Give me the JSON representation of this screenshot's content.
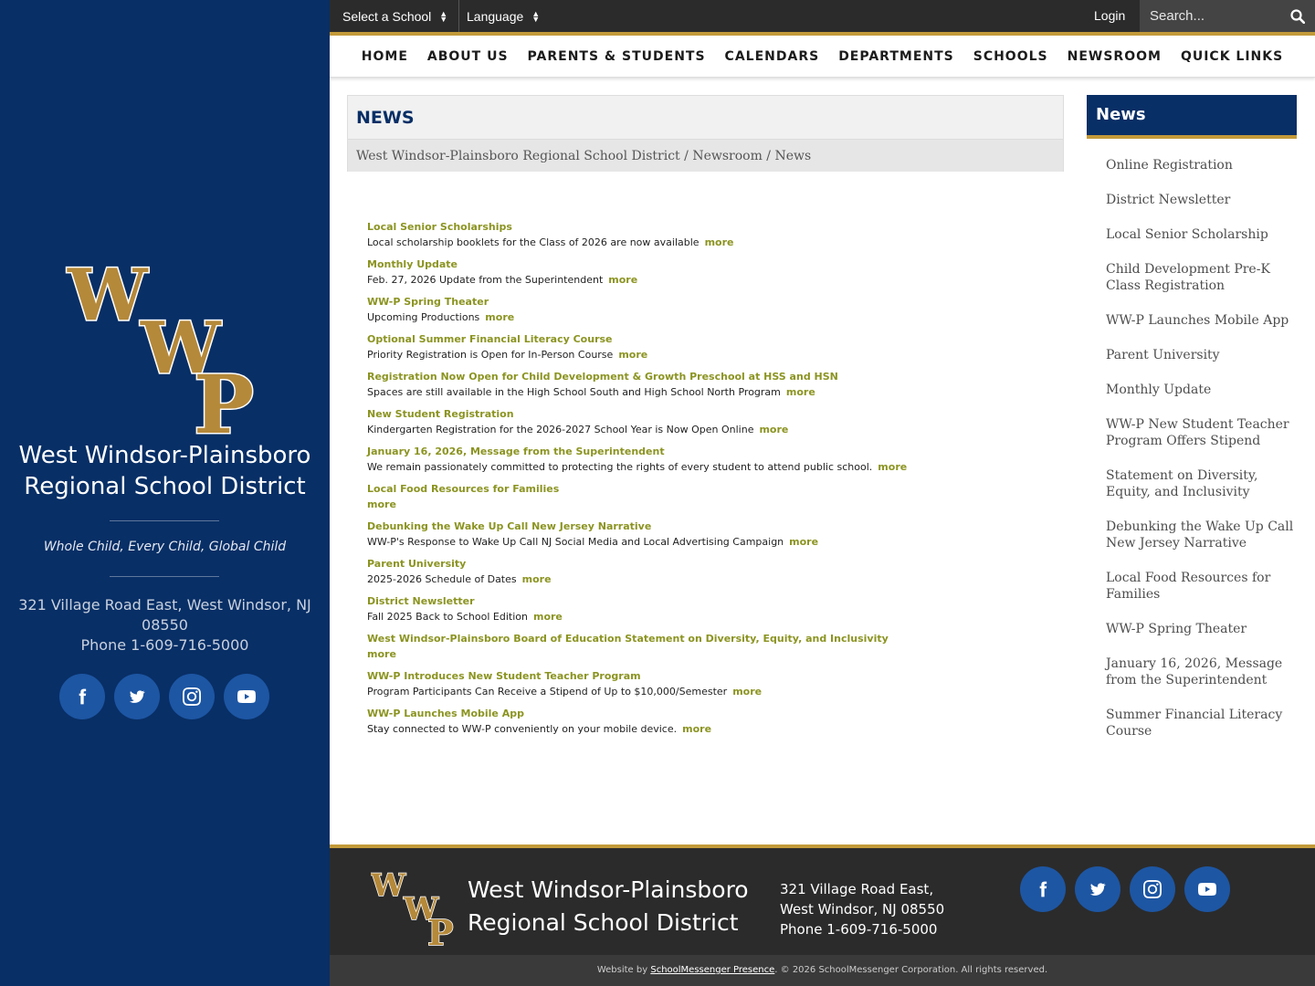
{
  "sidebar": {
    "district_name_line1": "West Windsor-Plainsboro",
    "district_name_line2": "Regional School District",
    "tagline": "Whole Child, Every Child, Global Child",
    "address_line1": "321 Village Road East, West Windsor, NJ",
    "address_line2": "08550",
    "phone": "Phone 1-609-716-5000",
    "logo_letters": [
      "W",
      "W",
      "P"
    ]
  },
  "topbar": {
    "select_school": "Select a School",
    "language": "Language",
    "login": "Login",
    "search_placeholder": "Search..."
  },
  "nav": {
    "items": [
      "HOME",
      "ABOUT US",
      "PARENTS & STUDENTS",
      "CALENDARS",
      "DEPARTMENTS",
      "SCHOOLS",
      "NEWSROOM",
      "QUICK LINKS"
    ]
  },
  "page": {
    "title": "NEWS",
    "breadcrumb": [
      "West Windsor-Plainsboro Regional School District",
      "Newsroom",
      "News"
    ],
    "breadcrumb_sep": " / "
  },
  "news": [
    {
      "title": "Local Senior Scholarships",
      "desc": "Local scholarship booklets for the Class of 2026 are now available",
      "more": "more"
    },
    {
      "title": "Monthly Update",
      "desc": "Feb. 27, 2026 Update from the Superintendent",
      "more": "more"
    },
    {
      "title": "WW-P Spring Theater",
      "desc": "Upcoming Productions",
      "more": "more"
    },
    {
      "title": "Optional Summer Financial Literacy Course",
      "desc": "Priority Registration is Open for In-Person Course",
      "more": "more"
    },
    {
      "title": "Registration Now Open for Child Development & Growth Preschool at HSS and HSN",
      "desc": "Spaces are still available in the High School South and High School North Program",
      "more": "more"
    },
    {
      "title": "New Student Registration",
      "desc": "Kindergarten Registration for the 2026-2027 School Year is Now Open Online",
      "more": "more"
    },
    {
      "title": "January 16, 2026, Message from the Superintendent",
      "desc": "We remain passionately committed to protecting the rights of every student to attend public school.",
      "more": "more"
    },
    {
      "title": "Local Food Resources for Families",
      "desc": "",
      "more": "more"
    },
    {
      "title": "Debunking the Wake Up Call New Jersey Narrative",
      "desc": "WW-P's Response to Wake Up Call NJ Social Media and Local Advertising Campaign",
      "more": "more"
    },
    {
      "title": "Parent University",
      "desc": "2025-2026 Schedule of Dates",
      "more": "more"
    },
    {
      "title": "District Newsletter",
      "desc": "Fall 2025 Back to School Edition",
      "more": "more"
    },
    {
      "title": "West Windsor-Plainsboro Board of Education Statement on Diversity, Equity, and Inclusivity",
      "desc": "",
      "more": "more"
    },
    {
      "title": "WW-P Introduces New Student Teacher Program",
      "desc": "Program Participants Can Receive a Stipend of Up to $10,000/Semester",
      "more": "more"
    },
    {
      "title": "WW-P Launches Mobile App",
      "desc": "Stay connected to WW-P conveniently on your mobile device.",
      "more": "more"
    }
  ],
  "rightnav": {
    "header": "News",
    "items": [
      "Online Registration",
      "District Newsletter",
      "Local Senior Scholarship",
      "Child Development Pre-K Class Registration",
      "WW-P Launches Mobile App",
      "Parent University",
      "Monthly Update",
      "WW-P New Student Teacher Program Offers Stipend",
      "Statement on Diversity, Equity, and Inclusivity",
      "Debunking the Wake Up Call New Jersey Narrative",
      "Local Food Resources for Families",
      "WW-P Spring Theater",
      "January 16, 2026, Message from the Superintendent",
      "Summer Financial Literacy Course"
    ]
  },
  "footer": {
    "name_line1": "West Windsor-Plainsboro",
    "name_line2": "Regional School District",
    "address_line1": "321 Village Road East,",
    "address_line2": "West Windsor, NJ 08550",
    "phone": "Phone 1-609-716-5000",
    "credit_prefix": "Website by ",
    "credit_link": "SchoolMessenger Presence",
    "credit_suffix": ". © 2026 SchoolMessenger Corporation. All rights reserved."
  },
  "social": [
    "facebook-icon",
    "twitter-icon",
    "instagram-icon",
    "youtube-icon"
  ],
  "colors": {
    "navy": "#082f66",
    "gold": "#c39a3a",
    "olive_link": "#8b9421",
    "social_circle": "#1d56a3",
    "dark_bar": "#2b2b2b"
  }
}
